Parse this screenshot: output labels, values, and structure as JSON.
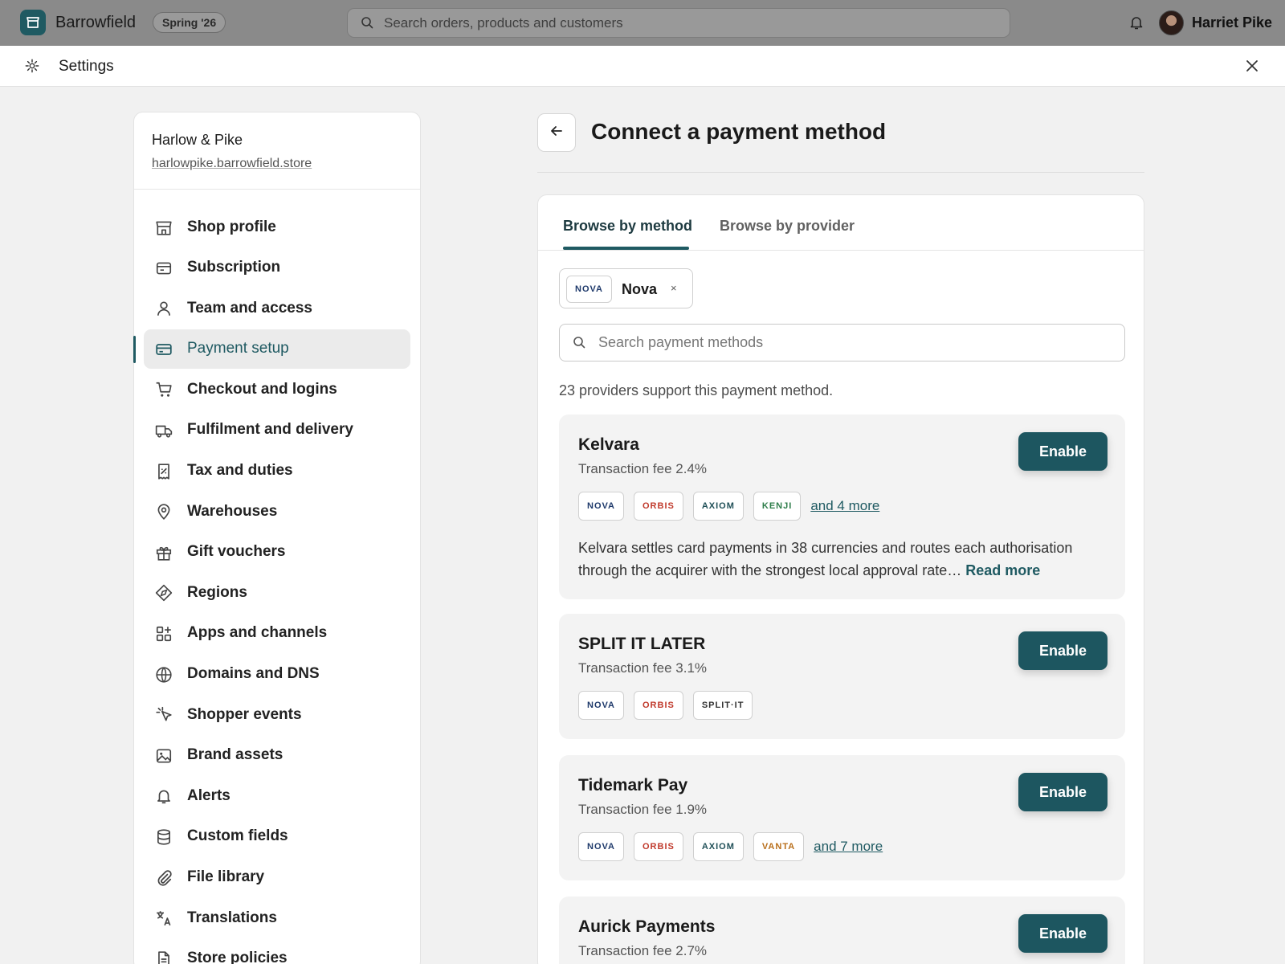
{
  "topbar": {
    "brand": "Barrowfield",
    "season_badge": "Spring '26",
    "search_placeholder": "Search orders, products and customers",
    "user_name": "Harriet Pike"
  },
  "settings_bar": {
    "title": "Settings"
  },
  "sidebar": {
    "shop_name": "Harlow & Pike",
    "shop_url": "harlowpike.barrowfield.store",
    "items": [
      {
        "label": "Shop profile",
        "icon": "store-icon"
      },
      {
        "label": "Subscription",
        "icon": "subscription-icon"
      },
      {
        "label": "Team and access",
        "icon": "person-icon"
      },
      {
        "label": "Payment setup",
        "icon": "credit-card-icon",
        "active": true
      },
      {
        "label": "Checkout and logins",
        "icon": "cart-icon"
      },
      {
        "label": "Fulfilment and delivery",
        "icon": "truck-icon"
      },
      {
        "label": "Tax and duties",
        "icon": "receipt-icon"
      },
      {
        "label": "Warehouses",
        "icon": "location-pin-icon"
      },
      {
        "label": "Gift vouchers",
        "icon": "gift-icon"
      },
      {
        "label": "Regions",
        "icon": "compass-icon"
      },
      {
        "label": "Apps and channels",
        "icon": "apps-icon"
      },
      {
        "label": "Domains and DNS",
        "icon": "globe-icon"
      },
      {
        "label": "Shopper events",
        "icon": "cursor-icon"
      },
      {
        "label": "Brand assets",
        "icon": "image-icon"
      },
      {
        "label": "Alerts",
        "icon": "bell-icon"
      },
      {
        "label": "Custom fields",
        "icon": "database-icon"
      },
      {
        "label": "File library",
        "icon": "paperclip-icon"
      },
      {
        "label": "Translations",
        "icon": "translate-icon"
      },
      {
        "label": "Store policies",
        "icon": "document-icon"
      }
    ]
  },
  "main": {
    "title": "Connect a payment method",
    "tabs": [
      {
        "label": "Browse by method",
        "active": true
      },
      {
        "label": "Browse by provider",
        "active": false
      }
    ],
    "filter_chip": {
      "badge": "NOVA",
      "label": "Nova",
      "remove": "×"
    },
    "search_placeholder": "Search payment methods",
    "count_text": "23 providers support this payment method.",
    "enable_label": "Enable",
    "providers": [
      {
        "name": "Kelvara",
        "fee": "Transaction fee 2.4%",
        "tags": [
          {
            "text": "NOVA",
            "color": "#1f3a6b"
          },
          {
            "text": "ORBIS",
            "color": "#c0392b"
          },
          {
            "text": "AXIOM",
            "color": "#1f4f57"
          },
          {
            "text": "KENJI",
            "color": "#2e7d4a"
          }
        ],
        "more": "and 4 more",
        "description": "Kelvara settles card payments in 38 currencies and routes each authorisation through the acquirer with the strongest local approval rate…",
        "read_more": "Read more"
      },
      {
        "name": "SPLIT IT LATER",
        "fee": "Transaction fee 3.1%",
        "tags": [
          {
            "text": "NOVA",
            "color": "#1f3a6b"
          },
          {
            "text": "ORBIS",
            "color": "#c0392b"
          },
          {
            "text": "SPLIT·IT",
            "color": "#333333"
          }
        ],
        "more": "",
        "description": "",
        "read_more": ""
      },
      {
        "name": "Tidemark Pay",
        "fee": "Transaction fee 1.9%",
        "tags": [
          {
            "text": "NOVA",
            "color": "#1f3a6b"
          },
          {
            "text": "ORBIS",
            "color": "#c0392b"
          },
          {
            "text": "AXIOM",
            "color": "#1f4f57"
          },
          {
            "text": "VANTA",
            "color": "#b86e1a"
          }
        ],
        "more": "and 7 more",
        "description": "",
        "read_more": ""
      },
      {
        "name": "Aurick Payments",
        "fee": "Transaction fee 2.7%",
        "tags": [],
        "more": "",
        "description": "",
        "read_more": ""
      }
    ]
  },
  "colors": {
    "accent": "#1f5a62",
    "topbar": "#8a8a8a",
    "background": "#f1f1f1"
  }
}
